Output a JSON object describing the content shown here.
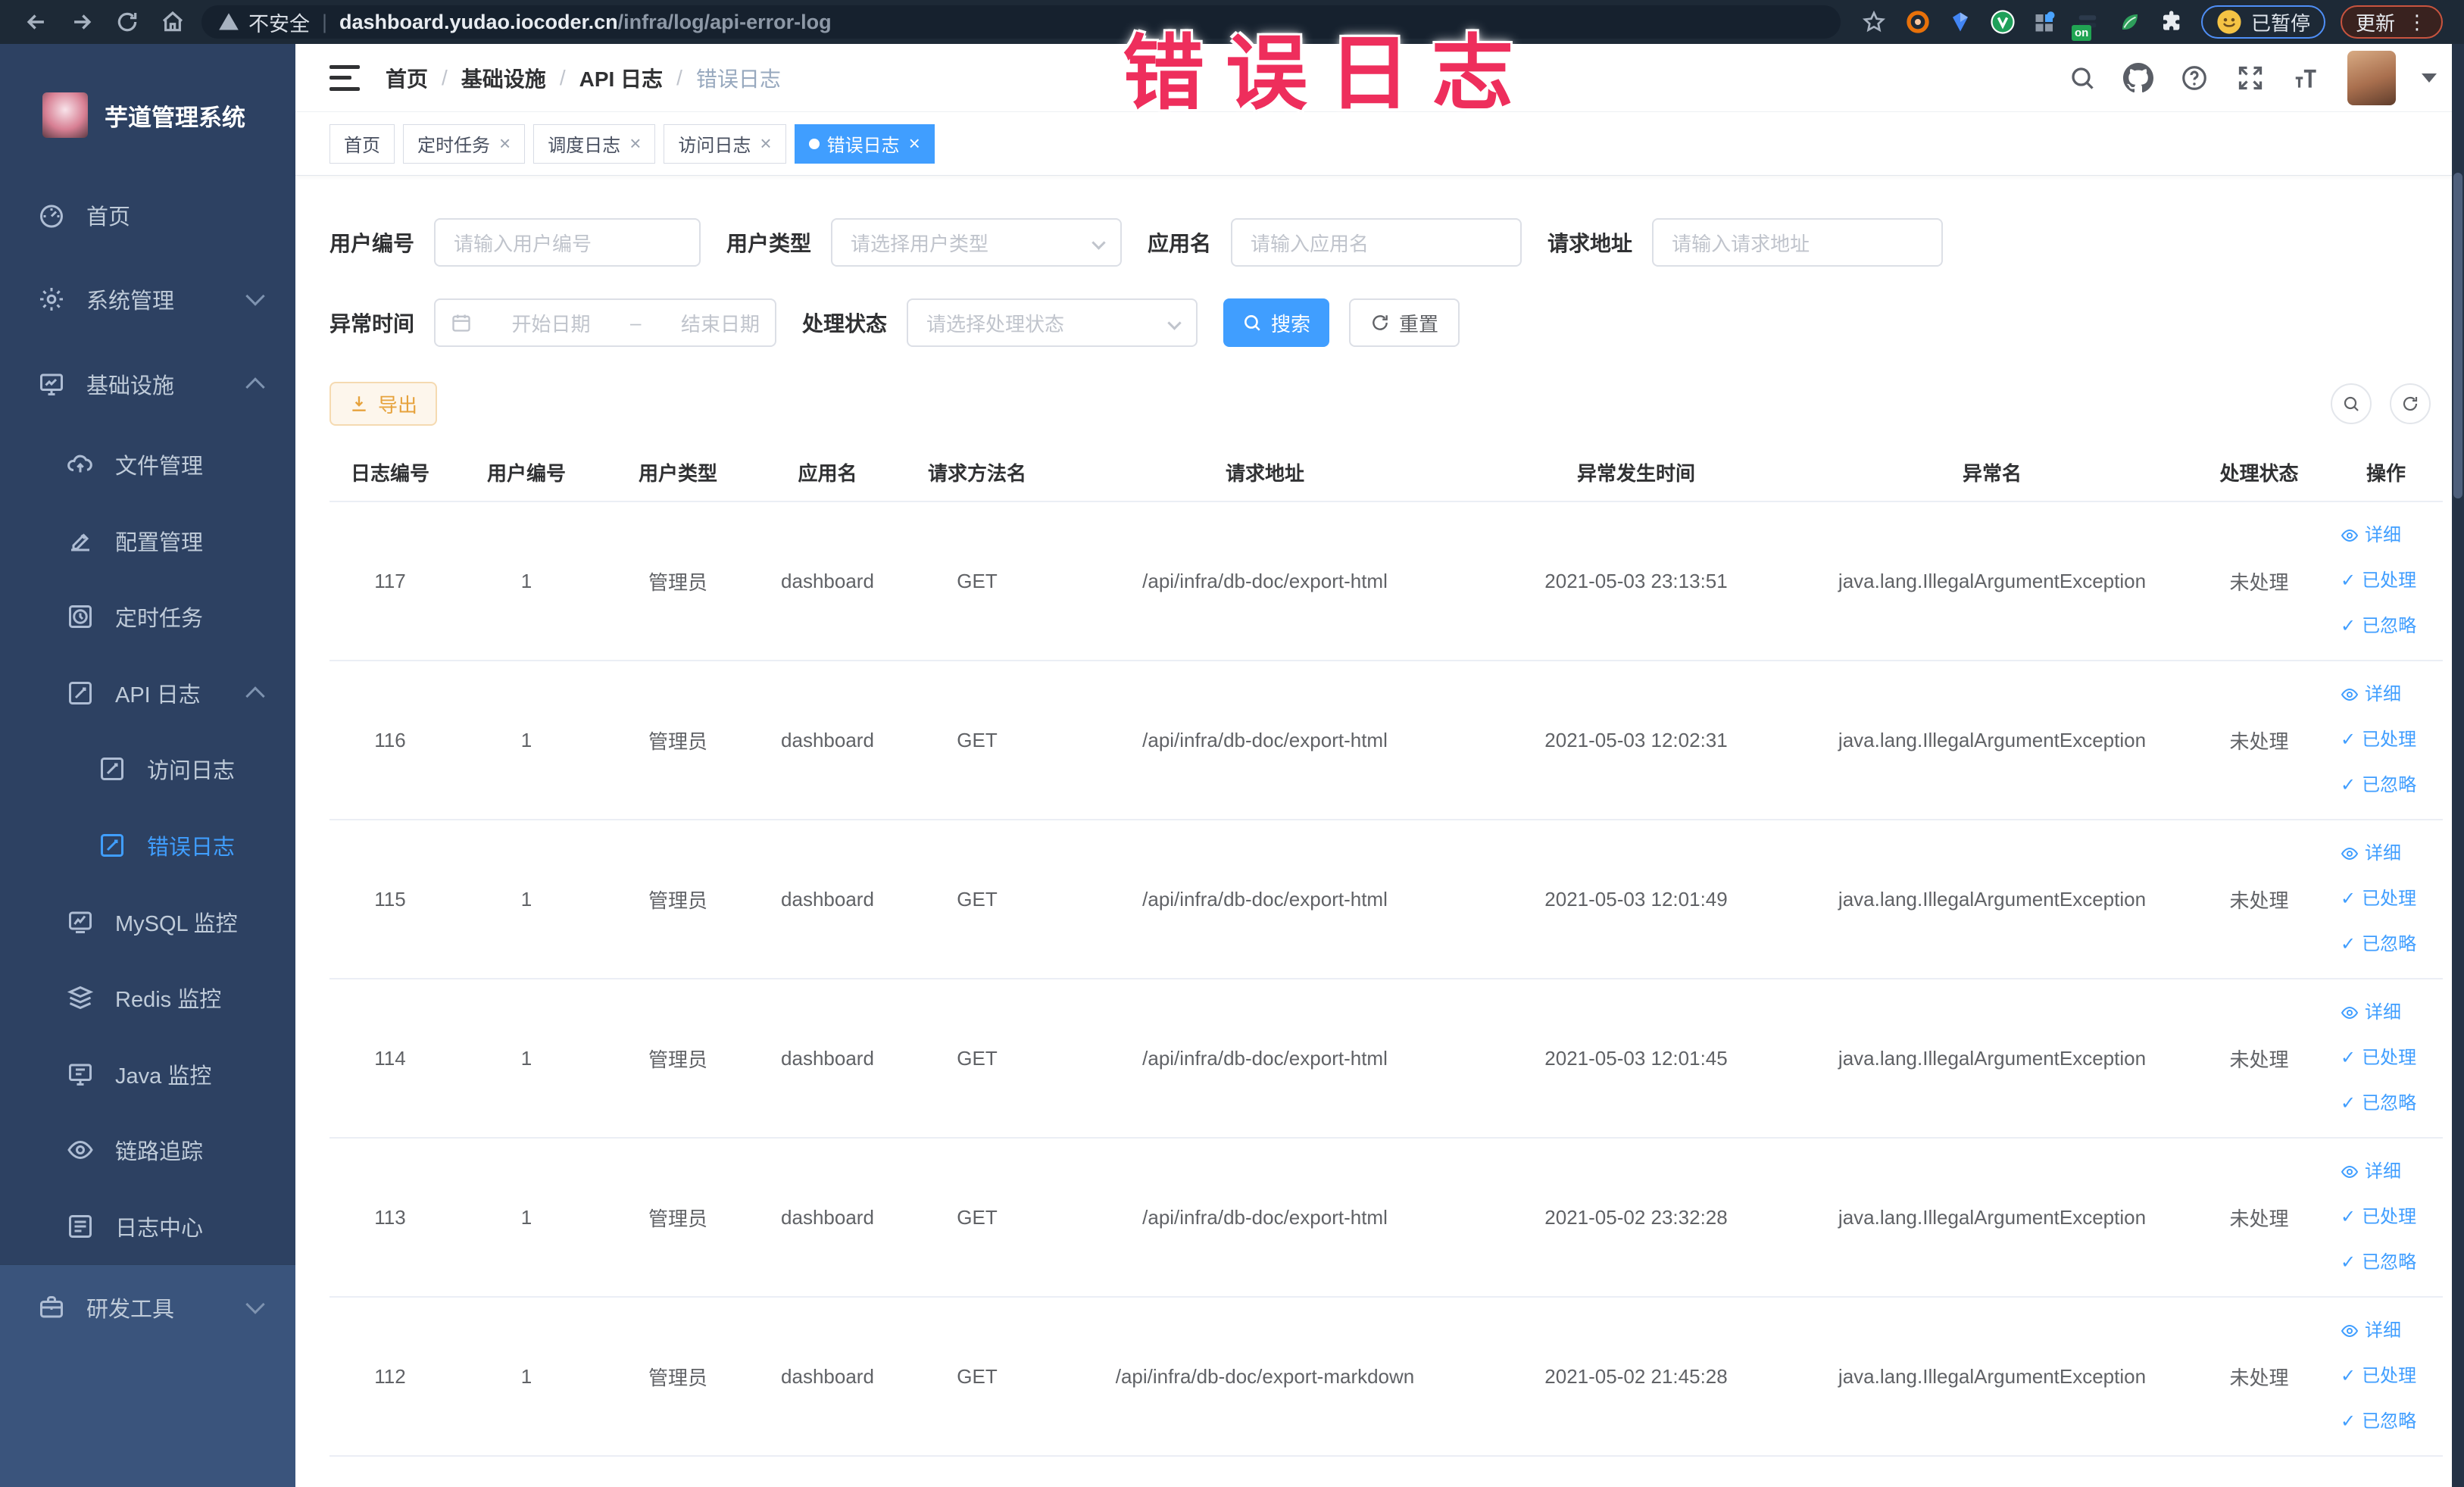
{
  "browser": {
    "security_label": "不安全",
    "url_host": "dashboard.yudao.iocoder.cn",
    "url_path": "/infra/log/api-error-log",
    "extension_badge": "on",
    "paused_label": "已暂停",
    "update_label": "更新"
  },
  "watermark": "错误日志",
  "sidebar": {
    "title": "芋道管理系统",
    "items": [
      {
        "label": "首页",
        "icon": "dashboard-icon"
      },
      {
        "label": "系统管理",
        "icon": "gear-icon"
      },
      {
        "label": "基础设施",
        "icon": "infrastructure-icon"
      },
      {
        "label": "文件管理",
        "icon": "file-upload-icon"
      },
      {
        "label": "配置管理",
        "icon": "config-icon"
      },
      {
        "label": "定时任务",
        "icon": "cron-icon"
      },
      {
        "label": "API 日志",
        "icon": "api-log-icon"
      },
      {
        "label": "访问日志",
        "icon": "access-log-icon"
      },
      {
        "label": "错误日志",
        "icon": "error-log-icon"
      },
      {
        "label": "MySQL 监控",
        "icon": "mysql-icon"
      },
      {
        "label": "Redis 监控",
        "icon": "redis-icon"
      },
      {
        "label": "Java 监控",
        "icon": "java-icon"
      },
      {
        "label": "链路追踪",
        "icon": "trace-icon"
      },
      {
        "label": "日志中心",
        "icon": "log-center-icon"
      },
      {
        "label": "研发工具",
        "icon": "devtools-icon"
      }
    ]
  },
  "header": {
    "breadcrumb": [
      "首页",
      "基础设施",
      "API 日志",
      "错误日志"
    ]
  },
  "tabs": [
    {
      "label": "首页",
      "closable": false,
      "active": false
    },
    {
      "label": "定时任务",
      "closable": true,
      "active": false
    },
    {
      "label": "调度日志",
      "closable": true,
      "active": false
    },
    {
      "label": "访问日志",
      "closable": true,
      "active": false
    },
    {
      "label": "错误日志",
      "closable": true,
      "active": true
    }
  ],
  "filters": {
    "user_id_label": "用户编号",
    "user_id_placeholder": "请输入用户编号",
    "user_type_label": "用户类型",
    "user_type_placeholder": "请选择用户类型",
    "app_name_label": "应用名",
    "app_name_placeholder": "请输入应用名",
    "request_url_label": "请求地址",
    "request_url_placeholder": "请输入请求地址",
    "exception_time_label": "异常时间",
    "date_start_placeholder": "开始日期",
    "date_separator": "–",
    "date_end_placeholder": "结束日期",
    "status_label": "处理状态",
    "status_placeholder": "请选择处理状态",
    "search_label": "搜索",
    "reset_label": "重置"
  },
  "toolbar": {
    "export_label": "导出"
  },
  "table": {
    "headers": [
      "日志编号",
      "用户编号",
      "用户类型",
      "应用名",
      "请求方法名",
      "请求地址",
      "异常发生时间",
      "异常名",
      "处理状态",
      "操作"
    ],
    "rows": [
      [
        "117",
        "1",
        "管理员",
        "dashboard",
        "GET",
        "/api/infra/db-doc/export-html",
        "2021-05-03 23:13:51",
        "java.lang.IllegalArgumentException",
        "未处理"
      ],
      [
        "116",
        "1",
        "管理员",
        "dashboard",
        "GET",
        "/api/infra/db-doc/export-html",
        "2021-05-03 12:02:31",
        "java.lang.IllegalArgumentException",
        "未处理"
      ],
      [
        "115",
        "1",
        "管理员",
        "dashboard",
        "GET",
        "/api/infra/db-doc/export-html",
        "2021-05-03 12:01:49",
        "java.lang.IllegalArgumentException",
        "未处理"
      ],
      [
        "114",
        "1",
        "管理员",
        "dashboard",
        "GET",
        "/api/infra/db-doc/export-html",
        "2021-05-03 12:01:45",
        "java.lang.IllegalArgumentException",
        "未处理"
      ],
      [
        "113",
        "1",
        "管理员",
        "dashboard",
        "GET",
        "/api/infra/db-doc/export-html",
        "2021-05-02 23:32:28",
        "java.lang.IllegalArgumentException",
        "未处理"
      ],
      [
        "112",
        "1",
        "管理员",
        "dashboard",
        "GET",
        "/api/infra/db-doc/export-markdown",
        "2021-05-02 21:45:28",
        "java.lang.IllegalArgumentException",
        "未处理"
      ]
    ],
    "row_actions": [
      {
        "name": "detail",
        "label": "详细"
      },
      {
        "name": "processed",
        "label": "已处理"
      },
      {
        "name": "ignored",
        "label": "已忽略"
      }
    ]
  },
  "colors": {
    "primary": "#409eff",
    "warning": "#e6a23c",
    "sidebar_bg": "#2d4162",
    "annotation": "#ee2e5c"
  }
}
